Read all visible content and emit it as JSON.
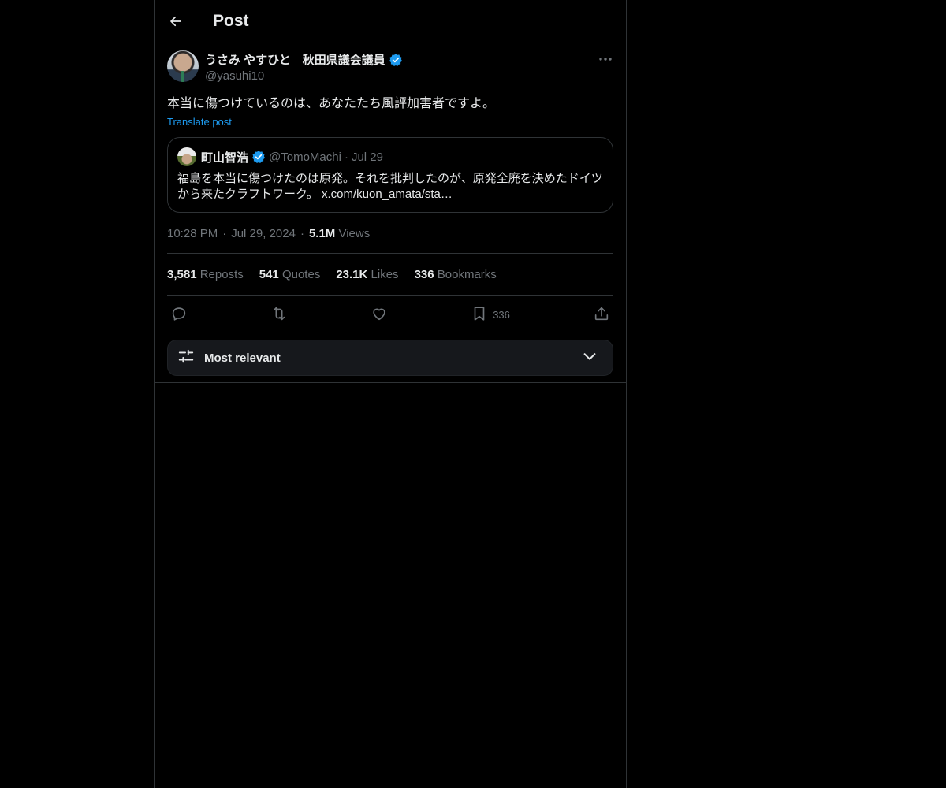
{
  "header": {
    "title": "Post"
  },
  "post": {
    "author_name": "うさみ やすひと　秋田県議会議員",
    "author_handle": "@yasuhi10",
    "text": "本当に傷つけているのは、あなたたち風評加害者ですよ。",
    "translate_label": "Translate post",
    "quote": {
      "name": "町山智浩",
      "handle": "@TomoMachi",
      "dot": "·",
      "date": "Jul 29",
      "text": "福島を本当に傷つけたのは原発。それを批判したのが、原発全廃を決めたドイツから来たクラフトワーク。 x.com/kuon_amata/sta…"
    },
    "time": "10:28 PM",
    "date": "Jul 29, 2024",
    "sep": "·",
    "views_count": "5.1M",
    "views_label": "Views"
  },
  "stats": [
    {
      "num": "3,581",
      "label": "Reposts"
    },
    {
      "num": "541",
      "label": "Quotes"
    },
    {
      "num": "23.1K",
      "label": "Likes"
    },
    {
      "num": "336",
      "label": "Bookmarks"
    }
  ],
  "actions": {
    "bookmark_count": "336"
  },
  "sort": {
    "label": "Most relevant"
  },
  "colors": {
    "background": "#000000",
    "text": "#e7e9ea",
    "muted": "#71767b",
    "accent": "#1d9bf0",
    "border": "#2f3336"
  }
}
